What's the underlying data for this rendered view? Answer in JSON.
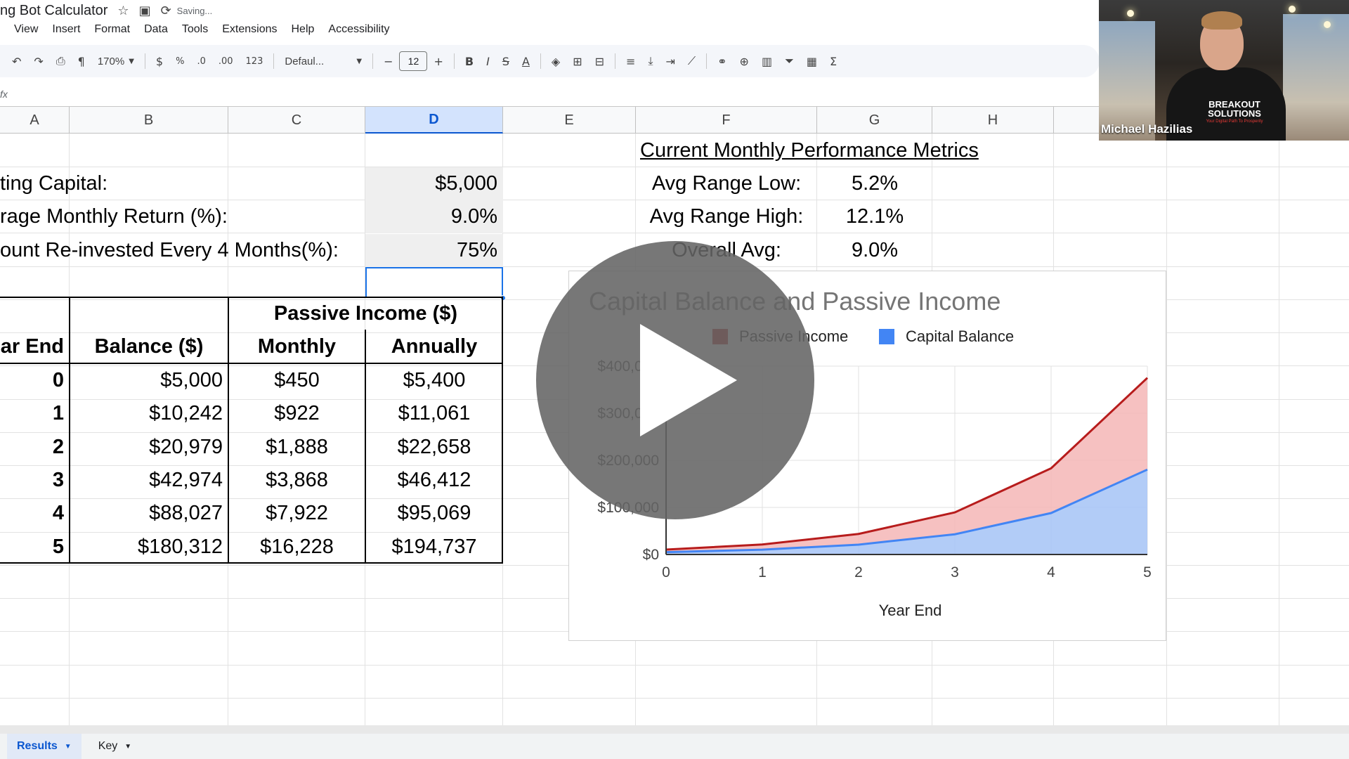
{
  "titlebar": {
    "doc_title": "ng Bot Calculator",
    "star_icon": "star-icon",
    "move_icon": "folder-move-icon",
    "saving_icon": "sync-icon",
    "saving_text": "Saving..."
  },
  "menu": [
    "View",
    "Insert",
    "Format",
    "Data",
    "Tools",
    "Extensions",
    "Help",
    "Accessibility"
  ],
  "toolbar": {
    "zoom": "170%",
    "currency": "$",
    "percent": "%",
    "dec_decrease": ".0",
    "dec_increase": ".00",
    "number_format": "123",
    "font_name": "Defaul...",
    "font_size": "12",
    "bold": "B",
    "italic": "I",
    "strike": "S",
    "text_color": "A",
    "sigma": "Σ"
  },
  "formula": {
    "fx": "fx"
  },
  "columns": [
    "A",
    "B",
    "C",
    "D",
    "E",
    "F",
    "G",
    "H"
  ],
  "inputs": {
    "starting_capital_label": "ting Capital:",
    "starting_capital_value": "$5,000",
    "monthly_return_label": "rage Monthly Return (%):",
    "monthly_return_value": "9.0%",
    "reinvest_label": "ount Re-invested Every 4 Months(%):",
    "reinvest_value": "75%"
  },
  "metrics": {
    "title": "Current Monthly Performance Metrics",
    "rows": [
      {
        "label": "Avg Range Low:",
        "value": "5.2%"
      },
      {
        "label": "Avg Range High:",
        "value": "12.1%"
      },
      {
        "label": "Overall Avg:",
        "value": "9.0%"
      }
    ]
  },
  "table": {
    "group_header": "Passive Income ($)",
    "headers": [
      "ar End",
      "Balance ($)",
      "Monthly",
      "Annually"
    ],
    "rows": [
      [
        "0",
        "$5,000",
        "$450",
        "$5,400"
      ],
      [
        "1",
        "$10,242",
        "$922",
        "$11,061"
      ],
      [
        "2",
        "$20,979",
        "$1,888",
        "$22,658"
      ],
      [
        "3",
        "$42,974",
        "$3,868",
        "$46,412"
      ],
      [
        "4",
        "$88,027",
        "$7,922",
        "$95,069"
      ],
      [
        "5",
        "$180,312",
        "$16,228",
        "$194,737"
      ]
    ]
  },
  "chart_data": {
    "type": "area",
    "stacked": true,
    "title": "Capital Balance and Passive Income",
    "xlabel": "Year End",
    "ylabel": "",
    "x": [
      0,
      1,
      2,
      3,
      4,
      5
    ],
    "xticks": [
      "0",
      "1",
      "2",
      "3",
      "4",
      "5"
    ],
    "yticks": [
      "$0",
      "$100,000",
      "$200,000",
      "$300,000",
      "$400,000"
    ],
    "ylim": [
      0,
      400000
    ],
    "legend_position": "top",
    "grid": true,
    "series": [
      {
        "name": "Passive Income",
        "color": "#b71c1c",
        "fill": "#f4b6b6",
        "values": [
          5400,
          11061,
          22658,
          46412,
          95069,
          194737
        ]
      },
      {
        "name": "Capital Balance",
        "color": "#4285f4",
        "fill": "#aac6f6",
        "values": [
          5000,
          10242,
          20979,
          42974,
          88027,
          180312
        ]
      }
    ]
  },
  "webcam": {
    "name": "Michael Hazilias",
    "shirt_logo": "BREAKOUT SOLUTIONS",
    "shirt_tagline": "Your Digital Path To Prosperity"
  },
  "sheets": [
    {
      "name": "Results",
      "active": true
    },
    {
      "name": "Key",
      "active": false
    }
  ],
  "colors": {
    "selected_blue": "#1a73e8",
    "header_selected": "#d3e3fd",
    "input_gray": "#efefef"
  }
}
